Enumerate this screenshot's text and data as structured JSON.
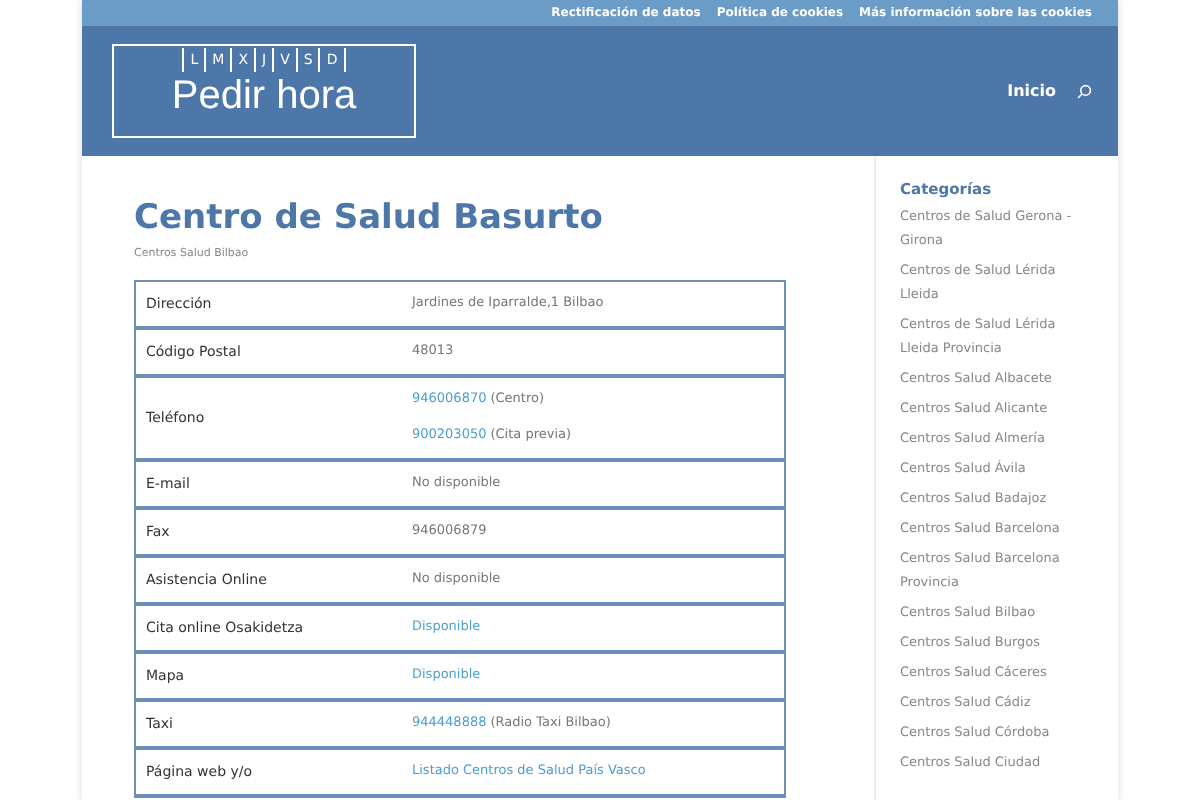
{
  "top_links": [
    "Rectificación de datos",
    "Política de cookies",
    "Más información sobre las cookies"
  ],
  "logo": {
    "days": [
      "L",
      "M",
      "X",
      "J",
      "V",
      "S",
      "D"
    ],
    "title": "Pedir hora"
  },
  "nav": [
    "Inicio"
  ],
  "title": "Centro de Salud Basurto",
  "category": "Centros Salud Bilbao",
  "rows": [
    {
      "label": "Dirección",
      "lines": [
        {
          "text": "Jardines de Iparralde,1 Bilbao"
        }
      ]
    },
    {
      "label": "Código Postal",
      "lines": [
        {
          "text": "48013"
        }
      ]
    },
    {
      "label": "Teléfono",
      "lines": [
        {
          "link": "946006870",
          "text": "(Centro)"
        },
        {
          "link": "900203050",
          "text": "(Cita previa)"
        }
      ]
    },
    {
      "label": "E-mail",
      "lines": [
        {
          "text": "No disponible"
        }
      ]
    },
    {
      "label": "Fax",
      "lines": [
        {
          "text": "946006879"
        }
      ]
    },
    {
      "label": "Asistencia Online",
      "lines": [
        {
          "text": "No disponible"
        }
      ]
    },
    {
      "label": "Cita online Osakidetza",
      "lines": [
        {
          "link": "Disponible"
        }
      ]
    },
    {
      "label": "Mapa",
      "lines": [
        {
          "link": "Disponible"
        }
      ]
    },
    {
      "label": "Taxi",
      "lines": [
        {
          "link": "944448888",
          "text": "(Radio Taxi Bilbao)"
        }
      ]
    },
    {
      "label": "Página web y/o",
      "lines": [
        {
          "link": "Listado Centros de Salud País Vasco"
        }
      ]
    }
  ],
  "sidebar": {
    "title": "Categorías",
    "items": [
      "Centros de Salud Gerona - Girona",
      "Centros de Salud Lérida Lleida",
      "Centros de Salud Lérida Lleida Provincia",
      "Centros Salud Albacete",
      "Centros Salud Alicante",
      "Centros Salud Almería",
      "Centros Salud Ávila",
      "Centros Salud Badajoz",
      "Centros Salud Barcelona",
      "Centros Salud Barcelona Provincia",
      "Centros Salud Bilbao",
      "Centros Salud Burgos",
      "Centros Salud Cáceres",
      "Centros Salud Cádiz",
      "Centros Salud Córdoba",
      "Centros Salud Ciudad"
    ]
  }
}
